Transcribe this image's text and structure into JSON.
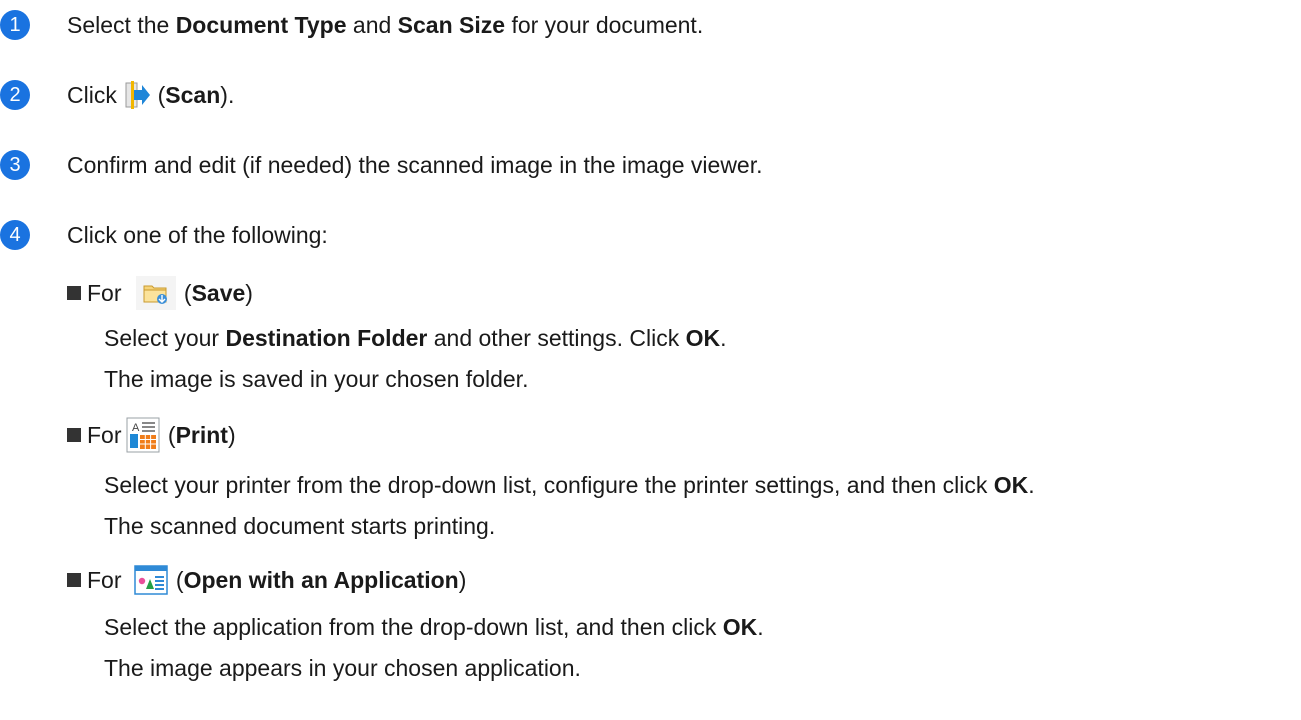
{
  "steps": [
    {
      "number": "1",
      "pre": "Select the ",
      "bold1": "Document Type",
      "mid": " and ",
      "bold2": "Scan Size",
      "post": " for your document."
    },
    {
      "number": "2",
      "pre": "Click ",
      "open": " (",
      "bold": "Scan",
      "close": ")."
    },
    {
      "number": "3",
      "text": "Confirm and edit (if needed) the scanned image in the image viewer."
    },
    {
      "number": "4",
      "text": "Click one of the following:"
    }
  ],
  "options": {
    "save": {
      "for": "For",
      "open": " (",
      "bold": "Save",
      "close": ")",
      "line1_pre": "Select your ",
      "line1_bold": "Destination Folder",
      "line1_mid": " and other settings. Click ",
      "line1_bold2": "OK",
      "line1_post": ".",
      "line2": "The image is saved in your chosen folder."
    },
    "print": {
      "for": "For",
      "open": " (",
      "bold": "Print",
      "close": ")",
      "line1_pre": "Select your printer from the drop-down list, configure the printer settings, and then click ",
      "line1_bold": "OK",
      "line1_post": ".",
      "line2": "The scanned document starts printing."
    },
    "open_app": {
      "for": "For",
      "open": " (",
      "bold": "Open with an Application",
      "close": ")",
      "line1_pre": "Select the application from the drop-down list, and then click ",
      "line1_bold": "OK",
      "line1_post": ".",
      "line2": "The image appears in your chosen application."
    }
  },
  "colors": {
    "badge": "#1a73e0",
    "text": "#1a1a1a"
  },
  "icons": {
    "scan": "scan-icon",
    "save": "folder-save-icon",
    "print": "print-icon",
    "open_app": "open-application-icon"
  }
}
